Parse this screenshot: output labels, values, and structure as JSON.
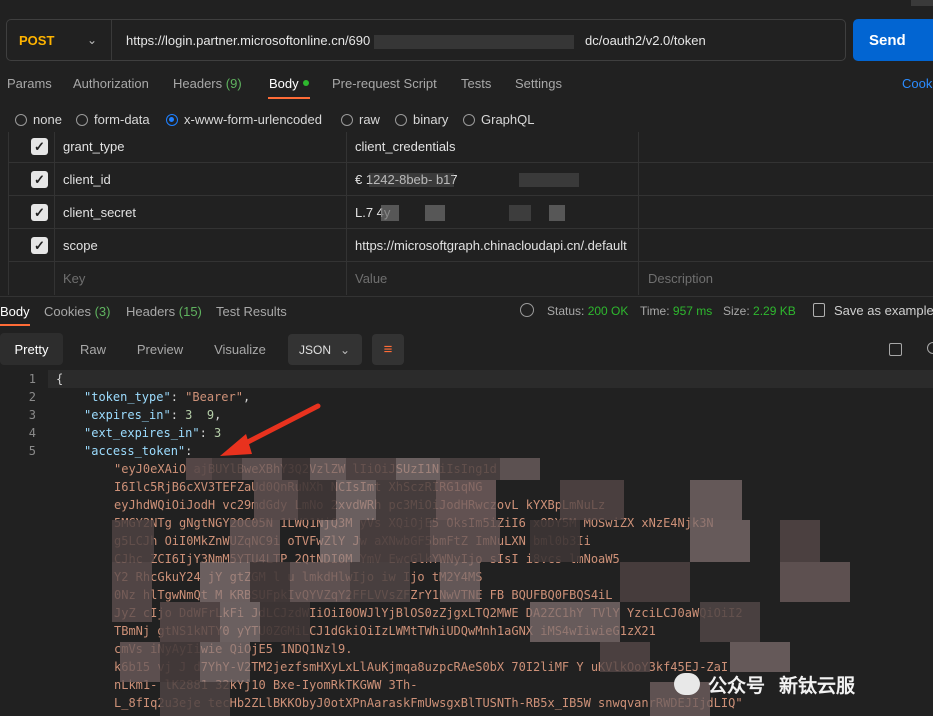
{
  "request": {
    "method": "POST",
    "url_start": "https://login.partner.microsoftonline.cn/690",
    "url_end": "dc/oauth2/v2.0/token",
    "send_label": "Send"
  },
  "req_tabs": {
    "params": "Params",
    "authorization": "Authorization",
    "headers": "Headers",
    "headers_count": "(9)",
    "body": "Body",
    "prerequest": "Pre-request Script",
    "tests": "Tests",
    "settings": "Settings",
    "cookies": "Cook"
  },
  "body_types": {
    "none": "none",
    "form_data": "form-data",
    "urlencoded": "x-www-form-urlencoded",
    "raw": "raw",
    "binary": "binary",
    "graphql": "GraphQL",
    "selected": "x-www-form-urlencoded"
  },
  "params": {
    "rows": [
      {
        "key": "grant_type",
        "value": "client_credentials"
      },
      {
        "key": "client_id",
        "value": "€                  1242-8beb-           b17"
      },
      {
        "key": "client_secret",
        "value": "L.7                                    4y"
      },
      {
        "key": "scope",
        "value": "https://microsoftgraph.chinacloudapi.cn/.default"
      }
    ],
    "key_placeholder": "Key",
    "value_placeholder": "Value",
    "description_placeholder": "Description"
  },
  "response": {
    "tabs": {
      "body": "Body",
      "cookies": "Cookies",
      "cookies_count": "(3)",
      "headers": "Headers",
      "headers_count": "(15)",
      "test_results": "Test Results"
    },
    "status_label": "Status:",
    "status_value": "200 OK",
    "time_label": "Time:",
    "time_value": "957 ms",
    "size_label": "Size:",
    "size_value": "2.29 KB",
    "save_label": "Save as example"
  },
  "view": {
    "pretty": "Pretty",
    "raw": "Raw",
    "preview": "Preview",
    "visualize": "Visualize",
    "format": "JSON"
  },
  "code": {
    "line_numbers": [
      "1",
      "2",
      "3",
      "4",
      "5"
    ],
    "open_brace": "{",
    "token_type_key": "\"token_type\"",
    "token_type_value": "\"Bearer\"",
    "expires_in_key": "\"expires_in\"",
    "expires_in_value": "3  9",
    "ext_expires_in_key": "\"ext_expires_in\"",
    "ext_expires_in_value": "3",
    "access_token_key": "\"access_token\"",
    "token_lines": [
      "\"eyJ0eXAiO                                   ajBUYlBweXBhY3Q2VzlZW        lIiOiJSUzI1NiIsIng1d",
      "I6Ilc5RjB6cXV3TEFZaUd0QnRuNXh           NCIsImt                 XhSczRIRG1qNG",
      "eyJhdWQiOiJodH         vc29mdGdy        LmNo        2xvdWRh          pc3MiOiJodHRwczovL        kYXBpLmNuLz",
      "5MGY2NTg     gNgtNGY2OC05N     1LWQ1NjQ3M          yVs        XQiOjE5       OksIm5iZiI6     xODY5M     MOSwiZX     xNzE4Njk3N",
      "g5LCJh      OiI0MkZnWUZqNC9i     oTVFwZlY        Jw                   aXNwbGF5bmFtZ    ImNuLXN          bml0b3Ii",
      "CJhc    ZCI6IjY3NmM5YTU4LTP    2QtNDI0M      YmV                    EwcGlkYWNyIjo   sIsI           i8vcs   lmNoaW5",
      "Y2     RhcGkuY24          jY    gtZGM        l      u           lmkdHlwIjo    iw        Ijo        tM2Y4MS",
      "0Nz   hlTgwNmQt                M                   KRBSUFpkIvQYVZqY2FFLVVsZFZrY1NwVTNE  FB          BQUFBQ0FBQS4iL",
      "JyZ               cIjo   DdWFrLkFi   JdLCJzdWIiOiI0OWJlYjBlOS0zZjgxLTQ2MWE    DA2ZC1hY       TVlY     YzciLCJ0aWQiOiI2",
      "TBmNj            gtNS1kNTY0     yYTU0ZGMiLCJ1dGkiOiIzLWMtTWhiUDQwMnh1aGNX              iMS4wIiwieG1zX21",
      "cmVs    iNyAyIiwie            QiOjE5   1NDQ1Nzl9.",
      "k6b15    vj     J              d7YhY-V2TM2jezfsmHXyLxLlAuKjmqa8uzpcRAeS0bX    70I2liMF   Y     uKVlkOoY3kf45EJ-ZaI",
      "nLkm1-     lK2881                                                            32kYj10       Bxe-IyomRkTKGWW         3Th-",
      "L_8fIq2u3eje         tecHb2ZLlBKKObyJ0otXPnAaraskFmUwsgxBlTUSNTh-RB5x_IB5W         snwqvanrRWDEJIjdLIQ\""
    ]
  },
  "watermark": {
    "label1": "公众号",
    "label2": "新钛云服"
  }
}
